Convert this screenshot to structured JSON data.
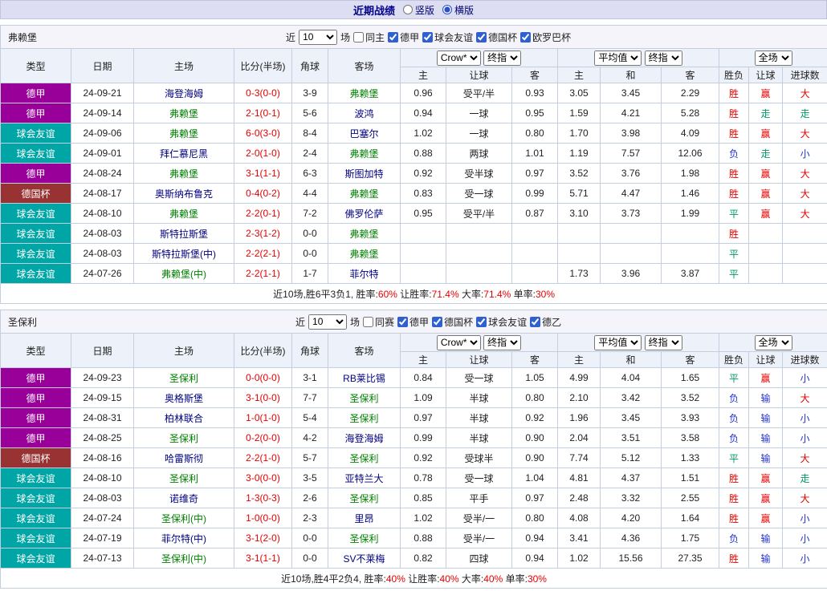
{
  "title_bar": {
    "title": "近期战绩",
    "options": [
      {
        "label": "竖版",
        "selected": false
      },
      {
        "label": "横版",
        "selected": true
      }
    ]
  },
  "colors": {
    "win": "#e60000",
    "draw": "#009966",
    "loss": "#2233cc",
    "league_dejia": "#990099",
    "league_friendly": "#00a6a6",
    "league_cup": "#993333",
    "team_highlight": "#008000",
    "title_bar_bg": "#dedef2",
    "header_bg": "#edf1f9"
  },
  "sections": [
    {
      "team": "弗赖堡",
      "filter": {
        "near_label": "近",
        "count": "10",
        "unit_label": "场",
        "same_label": "同主",
        "same_checked": false,
        "leagues": [
          {
            "label": "德甲",
            "checked": true
          },
          {
            "label": "球会友谊",
            "checked": true
          },
          {
            "label": "德国杯",
            "checked": true
          },
          {
            "label": "欧罗巴杯",
            "checked": true
          }
        ]
      },
      "col_selects": {
        "odds_source": "Crow*",
        "odds_kind": "终指",
        "avg_source": "平均值",
        "avg_kind": "终指",
        "scope": "全场"
      },
      "headers": {
        "type": "类型",
        "date": "日期",
        "home": "主场",
        "score": "比分(半场)",
        "corner": "角球",
        "away": "客场",
        "odds_home": "主",
        "handicap": "让球",
        "odds_away": "客",
        "avg_home": "主",
        "avg_draw": "和",
        "avg_away": "客",
        "result": "胜负",
        "let_result": "让球",
        "goals": "进球数"
      },
      "rows": [
        {
          "type": "德甲",
          "date": "24-09-21",
          "home": "海登海姆",
          "homeHl": false,
          "score": "0-3(0-0)",
          "corner": "3-9",
          "away": "弗赖堡",
          "awayHl": true,
          "oddsHome": "0.96",
          "handicap": "受平/半",
          "oddsAway": "0.93",
          "avgHome": "3.05",
          "avgDraw": "3.45",
          "avgAway": "2.29",
          "result": "胜",
          "resultColor": "red",
          "letResult": "赢",
          "letColor": "red",
          "goals": "大",
          "goalsColor": "red"
        },
        {
          "type": "德甲",
          "date": "24-09-14",
          "home": "弗赖堡",
          "homeHl": true,
          "score": "2-1(0-1)",
          "corner": "5-6",
          "away": "波鸿",
          "awayHl": false,
          "oddsHome": "0.94",
          "handicap": "一球",
          "oddsAway": "0.95",
          "avgHome": "1.59",
          "avgDraw": "4.21",
          "avgAway": "5.28",
          "result": "胜",
          "resultColor": "red",
          "letResult": "走",
          "letColor": "green",
          "goals": "走",
          "goalsColor": "green"
        },
        {
          "type": "球会友谊",
          "date": "24-09-06",
          "home": "弗赖堡",
          "homeHl": true,
          "score": "6-0(3-0)",
          "corner": "8-4",
          "away": "巴塞尔",
          "awayHl": false,
          "oddsHome": "1.02",
          "handicap": "一球",
          "oddsAway": "0.80",
          "avgHome": "1.70",
          "avgDraw": "3.98",
          "avgAway": "4.09",
          "result": "胜",
          "resultColor": "red",
          "letResult": "赢",
          "letColor": "red",
          "goals": "大",
          "goalsColor": "red"
        },
        {
          "type": "球会友谊",
          "date": "24-09-01",
          "home": "拜仁慕尼黑",
          "homeHl": false,
          "score": "2-0(1-0)",
          "corner": "2-4",
          "away": "弗赖堡",
          "awayHl": true,
          "oddsHome": "0.88",
          "handicap": "两球",
          "oddsAway": "1.01",
          "avgHome": "1.19",
          "avgDraw": "7.57",
          "avgAway": "12.06",
          "result": "负",
          "resultColor": "blue",
          "letResult": "走",
          "letColor": "green",
          "goals": "小",
          "goalsColor": "blue"
        },
        {
          "type": "德甲",
          "date": "24-08-24",
          "home": "弗赖堡",
          "homeHl": true,
          "score": "3-1(1-1)",
          "corner": "6-3",
          "away": "斯图加特",
          "awayHl": false,
          "oddsHome": "0.92",
          "handicap": "受半球",
          "oddsAway": "0.97",
          "avgHome": "3.52",
          "avgDraw": "3.76",
          "avgAway": "1.98",
          "result": "胜",
          "resultColor": "red",
          "letResult": "赢",
          "letColor": "red",
          "goals": "大",
          "goalsColor": "red"
        },
        {
          "type": "德国杯",
          "date": "24-08-17",
          "home": "奥斯纳布鲁克",
          "homeHl": false,
          "score": "0-4(0-2)",
          "corner": "4-4",
          "away": "弗赖堡",
          "awayHl": true,
          "oddsHome": "0.83",
          "handicap": "受一球",
          "oddsAway": "0.99",
          "avgHome": "5.71",
          "avgDraw": "4.47",
          "avgAway": "1.46",
          "result": "胜",
          "resultColor": "red",
          "letResult": "赢",
          "letColor": "red",
          "goals": "大",
          "goalsColor": "red"
        },
        {
          "type": "球会友谊",
          "date": "24-08-10",
          "home": "弗赖堡",
          "homeHl": true,
          "score": "2-2(0-1)",
          "corner": "7-2",
          "away": "佛罗伦萨",
          "awayHl": false,
          "oddsHome": "0.95",
          "handicap": "受平/半",
          "oddsAway": "0.87",
          "avgHome": "3.10",
          "avgDraw": "3.73",
          "avgAway": "1.99",
          "result": "平",
          "resultColor": "green",
          "letResult": "赢",
          "letColor": "red",
          "goals": "大",
          "goalsColor": "red"
        },
        {
          "type": "球会友谊",
          "date": "24-08-03",
          "home": "斯特拉斯堡",
          "homeHl": false,
          "score": "2-3(1-2)",
          "corner": "0-0",
          "away": "弗赖堡",
          "awayHl": true,
          "oddsHome": "",
          "handicap": "",
          "oddsAway": "",
          "avgHome": "",
          "avgDraw": "",
          "avgAway": "",
          "result": "胜",
          "resultColor": "red",
          "letResult": "",
          "letColor": "",
          "goals": "",
          "goalsColor": ""
        },
        {
          "type": "球会友谊",
          "date": "24-08-03",
          "home": "斯特拉斯堡(中)",
          "homeHl": false,
          "score": "2-2(2-1)",
          "corner": "0-0",
          "away": "弗赖堡",
          "awayHl": true,
          "oddsHome": "",
          "handicap": "",
          "oddsAway": "",
          "avgHome": "",
          "avgDraw": "",
          "avgAway": "",
          "result": "平",
          "resultColor": "green",
          "letResult": "",
          "letColor": "",
          "goals": "",
          "goalsColor": ""
        },
        {
          "type": "球会友谊",
          "date": "24-07-26",
          "home": "弗赖堡(中)",
          "homeHl": true,
          "score": "2-2(1-1)",
          "corner": "1-7",
          "away": "菲尔特",
          "awayHl": false,
          "oddsHome": "",
          "handicap": "",
          "oddsAway": "",
          "avgHome": "1.73",
          "avgDraw": "3.96",
          "avgAway": "3.87",
          "result": "平",
          "resultColor": "green",
          "letResult": "",
          "letColor": "",
          "goals": "",
          "goalsColor": ""
        }
      ],
      "summary": [
        {
          "text": "近10场,胜6平3负1, ",
          "red": false
        },
        {
          "text": "胜率:",
          "red": false
        },
        {
          "text": "60%",
          "red": true
        },
        {
          "text": " 让胜率:",
          "red": false
        },
        {
          "text": "71.4%",
          "red": true
        },
        {
          "text": " 大率:",
          "red": false
        },
        {
          "text": "71.4%",
          "red": true
        },
        {
          "text": " 单率:",
          "red": false
        },
        {
          "text": "30%",
          "red": true
        }
      ]
    },
    {
      "team": "圣保利",
      "filter": {
        "near_label": "近",
        "count": "10",
        "unit_label": "场",
        "same_label": "同赛",
        "same_checked": false,
        "leagues": [
          {
            "label": "德甲",
            "checked": true
          },
          {
            "label": "德国杯",
            "checked": true
          },
          {
            "label": "球会友谊",
            "checked": true
          },
          {
            "label": "德乙",
            "checked": true
          }
        ]
      },
      "col_selects": {
        "odds_source": "Crow*",
        "odds_kind": "终指",
        "avg_source": "平均值",
        "avg_kind": "终指",
        "scope": "全场"
      },
      "headers": {
        "type": "类型",
        "date": "日期",
        "home": "主场",
        "score": "比分(半场)",
        "corner": "角球",
        "away": "客场",
        "odds_home": "主",
        "handicap": "让球",
        "odds_away": "客",
        "avg_home": "主",
        "avg_draw": "和",
        "avg_away": "客",
        "result": "胜负",
        "let_result": "让球",
        "goals": "进球数"
      },
      "rows": [
        {
          "type": "德甲",
          "date": "24-09-23",
          "home": "圣保利",
          "homeHl": true,
          "score": "0-0(0-0)",
          "corner": "3-1",
          "away": "RB莱比锡",
          "awayHl": false,
          "oddsHome": "0.84",
          "handicap": "受一球",
          "oddsAway": "1.05",
          "avgHome": "4.99",
          "avgDraw": "4.04",
          "avgAway": "1.65",
          "result": "平",
          "resultColor": "green",
          "letResult": "赢",
          "letColor": "red",
          "goals": "小",
          "goalsColor": "blue"
        },
        {
          "type": "德甲",
          "date": "24-09-15",
          "home": "奥格斯堡",
          "homeHl": false,
          "score": "3-1(0-0)",
          "corner": "7-7",
          "away": "圣保利",
          "awayHl": true,
          "oddsHome": "1.09",
          "handicap": "半球",
          "oddsAway": "0.80",
          "avgHome": "2.10",
          "avgDraw": "3.42",
          "avgAway": "3.52",
          "result": "负",
          "resultColor": "blue",
          "letResult": "输",
          "letColor": "blue",
          "goals": "大",
          "goalsColor": "red"
        },
        {
          "type": "德甲",
          "date": "24-08-31",
          "home": "柏林联合",
          "homeHl": false,
          "score": "1-0(1-0)",
          "corner": "5-4",
          "away": "圣保利",
          "awayHl": true,
          "oddsHome": "0.97",
          "handicap": "半球",
          "oddsAway": "0.92",
          "avgHome": "1.96",
          "avgDraw": "3.45",
          "avgAway": "3.93",
          "result": "负",
          "resultColor": "blue",
          "letResult": "输",
          "letColor": "blue",
          "goals": "小",
          "goalsColor": "blue"
        },
        {
          "type": "德甲",
          "date": "24-08-25",
          "home": "圣保利",
          "homeHl": true,
          "score": "0-2(0-0)",
          "corner": "4-2",
          "away": "海登海姆",
          "awayHl": false,
          "oddsHome": "0.99",
          "handicap": "半球",
          "oddsAway": "0.90",
          "avgHome": "2.04",
          "avgDraw": "3.51",
          "avgAway": "3.58",
          "result": "负",
          "resultColor": "blue",
          "letResult": "输",
          "letColor": "blue",
          "goals": "小",
          "goalsColor": "blue"
        },
        {
          "type": "德国杯",
          "date": "24-08-16",
          "home": "哈雷斯彻",
          "homeHl": false,
          "score": "2-2(1-0)",
          "corner": "5-7",
          "away": "圣保利",
          "awayHl": true,
          "oddsHome": "0.92",
          "handicap": "受球半",
          "oddsAway": "0.90",
          "avgHome": "7.74",
          "avgDraw": "5.12",
          "avgAway": "1.33",
          "result": "平",
          "resultColor": "green",
          "letResult": "输",
          "letColor": "blue",
          "goals": "大",
          "goalsColor": "red"
        },
        {
          "type": "球会友谊",
          "date": "24-08-10",
          "home": "圣保利",
          "homeHl": true,
          "score": "3-0(0-0)",
          "corner": "3-5",
          "away": "亚特兰大",
          "awayHl": false,
          "oddsHome": "0.78",
          "handicap": "受一球",
          "oddsAway": "1.04",
          "avgHome": "4.81",
          "avgDraw": "4.37",
          "avgAway": "1.51",
          "result": "胜",
          "resultColor": "red",
          "letResult": "赢",
          "letColor": "red",
          "goals": "走",
          "goalsColor": "green"
        },
        {
          "type": "球会友谊",
          "date": "24-08-03",
          "home": "诺维奇",
          "homeHl": false,
          "score": "1-3(0-3)",
          "corner": "2-6",
          "away": "圣保利",
          "awayHl": true,
          "oddsHome": "0.85",
          "handicap": "平手",
          "oddsAway": "0.97",
          "avgHome": "2.48",
          "avgDraw": "3.32",
          "avgAway": "2.55",
          "result": "胜",
          "resultColor": "red",
          "letResult": "赢",
          "letColor": "red",
          "goals": "大",
          "goalsColor": "red"
        },
        {
          "type": "球会友谊",
          "date": "24-07-24",
          "home": "圣保利(中)",
          "homeHl": true,
          "score": "1-0(0-0)",
          "corner": "2-3",
          "away": "里昂",
          "awayHl": false,
          "oddsHome": "1.02",
          "handicap": "受半/一",
          "oddsAway": "0.80",
          "avgHome": "4.08",
          "avgDraw": "4.20",
          "avgAway": "1.64",
          "result": "胜",
          "resultColor": "red",
          "letResult": "赢",
          "letColor": "red",
          "goals": "小",
          "goalsColor": "blue"
        },
        {
          "type": "球会友谊",
          "date": "24-07-19",
          "home": "菲尔特(中)",
          "homeHl": false,
          "score": "3-1(2-0)",
          "corner": "0-0",
          "away": "圣保利",
          "awayHl": true,
          "oddsHome": "0.88",
          "handicap": "受半/一",
          "oddsAway": "0.94",
          "avgHome": "3.41",
          "avgDraw": "4.36",
          "avgAway": "1.75",
          "result": "负",
          "resultColor": "blue",
          "letResult": "输",
          "letColor": "blue",
          "goals": "小",
          "goalsColor": "blue"
        },
        {
          "type": "球会友谊",
          "date": "24-07-13",
          "home": "圣保利(中)",
          "homeHl": true,
          "score": "3-1(1-1)",
          "corner": "0-0",
          "away": "SV不莱梅",
          "awayHl": false,
          "oddsHome": "0.82",
          "handicap": "四球",
          "oddsAway": "0.94",
          "avgHome": "1.02",
          "avgDraw": "15.56",
          "avgAway": "27.35",
          "result": "胜",
          "resultColor": "red",
          "letResult": "输",
          "letColor": "blue",
          "goals": "小",
          "goalsColor": "blue"
        }
      ],
      "summary": [
        {
          "text": "近10场,胜4平2负4, ",
          "red": false
        },
        {
          "text": "胜率:",
          "red": false
        },
        {
          "text": "40%",
          "red": true
        },
        {
          "text": " 让胜率:",
          "red": false
        },
        {
          "text": "40%",
          "red": true
        },
        {
          "text": " 大率:",
          "red": false
        },
        {
          "text": "40%",
          "red": true
        },
        {
          "text": " 单率:",
          "red": false
        },
        {
          "text": "30%",
          "red": true
        }
      ]
    }
  ]
}
